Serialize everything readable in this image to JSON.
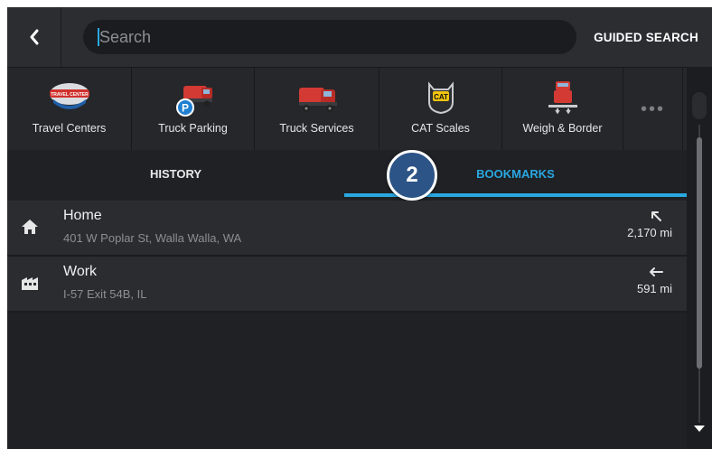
{
  "search": {
    "placeholder": "Search",
    "guided_label": "GUIDED SEARCH"
  },
  "categories": [
    {
      "label": "Travel Centers",
      "icon": "travel-center-icon",
      "badge": "TRAVEL CENTER"
    },
    {
      "label": "Truck Parking",
      "icon": "truck-parking-icon",
      "badge": "P"
    },
    {
      "label": "Truck Services",
      "icon": "truck-services-icon"
    },
    {
      "label": "CAT Scales",
      "icon": "cat-scale-icon",
      "badge": "CAT"
    },
    {
      "label": "Weigh & Border",
      "icon": "weigh-border-icon"
    }
  ],
  "more_label": "•••",
  "tabs": {
    "history": "HISTORY",
    "bookmarks": "BOOKMARKS",
    "active": "bookmarks"
  },
  "step_badge": "2",
  "bookmarks": [
    {
      "name": "Home",
      "address": "401 W Poplar St, Walla Walla, WA",
      "distance": "2,170 mi",
      "icon": "home-icon",
      "direction": "arrow-up-left-icon"
    },
    {
      "name": "Work",
      "address": "I-57 Exit 54B, IL",
      "distance": "591 mi",
      "icon": "work-building-icon",
      "direction": "arrow-left-icon"
    }
  ],
  "colors": {
    "accent": "#29a8e0",
    "background": "#1f2125",
    "panel": "#2a2c30",
    "badge": "#2c5486"
  }
}
